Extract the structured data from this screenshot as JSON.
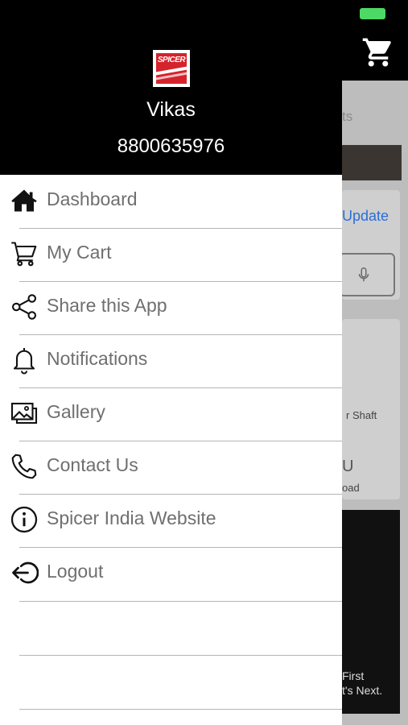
{
  "profile": {
    "brand": "SPICER",
    "name": "Vikas",
    "phone": "8800635976"
  },
  "menu": [
    {
      "label": "Dashboard",
      "icon": "home-icon"
    },
    {
      "label": "My Cart",
      "icon": "cart-icon"
    },
    {
      "label": "Share this App",
      "icon": "share-icon"
    },
    {
      "label": "Notifications",
      "icon": "bell-icon"
    },
    {
      "label": "Gallery",
      "icon": "gallery-icon"
    },
    {
      "label": "Contact Us",
      "icon": "phone-icon"
    },
    {
      "label": "Spicer India Website",
      "icon": "info-icon"
    },
    {
      "label": "Logout",
      "icon": "logout-icon"
    }
  ],
  "background": {
    "tab_fragment": "ts",
    "update_link": "Update",
    "shaft_label": "r Shaft",
    "u_fragment": "U",
    "load_label": "oad",
    "promo_line1": "First",
    "promo_line2": "t's Next."
  },
  "colors": {
    "drawer_header": "#000000",
    "menu_text": "#6f6f6f",
    "link_blue": "#2a6fd6",
    "battery": "#4cd964"
  }
}
